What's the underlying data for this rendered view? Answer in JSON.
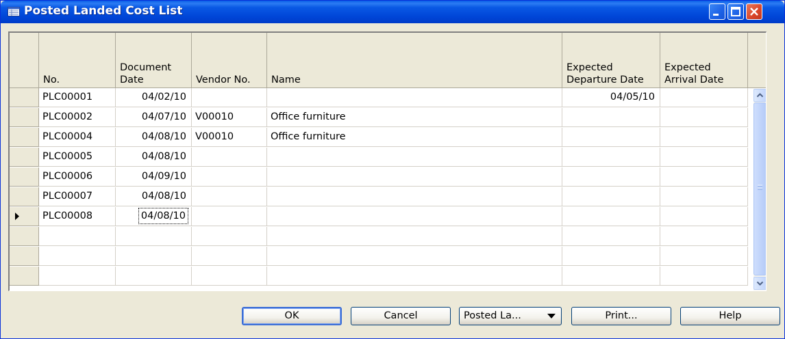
{
  "window": {
    "title": "Posted Landed Cost List",
    "title_icon": "list-form-icon",
    "controls": [
      "minimize-icon",
      "maximize-icon",
      "close-icon"
    ]
  },
  "table": {
    "columns": [
      {
        "key": "no",
        "label": "No."
      },
      {
        "key": "document_date",
        "label": "Document\nDate"
      },
      {
        "key": "vendor_no",
        "label": "Vendor No."
      },
      {
        "key": "name",
        "label": "Name"
      },
      {
        "key": "expected_departure_date",
        "label": "Expected\nDeparture Date"
      },
      {
        "key": "expected_arrival_date",
        "label": "Expected\nArrival Date"
      }
    ],
    "rows": [
      {
        "no": "PLC00001",
        "document_date": "04/02/10",
        "vendor_no": "",
        "name": "",
        "expected_departure_date": "04/05/10",
        "expected_arrival_date": ""
      },
      {
        "no": "PLC00002",
        "document_date": "04/07/10",
        "vendor_no": "V00010",
        "name": "Office furniture",
        "expected_departure_date": "",
        "expected_arrival_date": ""
      },
      {
        "no": "PLC00004",
        "document_date": "04/08/10",
        "vendor_no": "V00010",
        "name": "Office furniture",
        "expected_departure_date": "",
        "expected_arrival_date": ""
      },
      {
        "no": "PLC00005",
        "document_date": "04/08/10",
        "vendor_no": "",
        "name": "",
        "expected_departure_date": "",
        "expected_arrival_date": ""
      },
      {
        "no": "PLC00006",
        "document_date": "04/09/10",
        "vendor_no": "",
        "name": "",
        "expected_departure_date": "",
        "expected_arrival_date": ""
      },
      {
        "no": "PLC00007",
        "document_date": "04/08/10",
        "vendor_no": "",
        "name": "",
        "expected_departure_date": "",
        "expected_arrival_date": ""
      },
      {
        "no": "PLC00008",
        "document_date": "04/08/10",
        "vendor_no": "",
        "name": "",
        "expected_departure_date": "",
        "expected_arrival_date": ""
      }
    ],
    "empty_rows": 3,
    "current_row_indicator": "row-pointer-icon",
    "current_row": "PLC00008",
    "focused_cell": "04/08/10"
  },
  "scrollbar": {
    "up_icon": "chevron-up-icon",
    "down_icon": "chevron-down-icon",
    "grip_icon": "grip-icon"
  },
  "buttons": {
    "ok": "OK",
    "cancel": "Cancel",
    "posted_landed_cost": "Posted La...",
    "posted_landed_cost_icon": "dropdown-arrow-icon",
    "print": "Print...",
    "help": "Help"
  },
  "colors": {
    "titlebar": "#0a59e4",
    "face": "#ece9d8",
    "grid_line": "#d4d0c8",
    "default_button_border": "#3c6ed6"
  }
}
